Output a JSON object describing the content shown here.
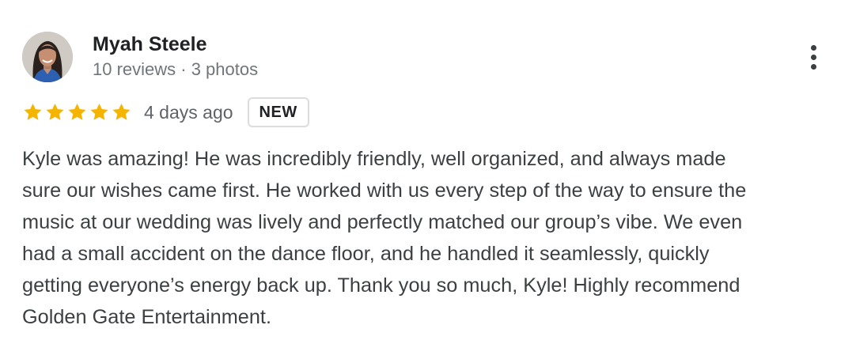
{
  "reviewer": {
    "name": "Myah Steele",
    "meta": "10 reviews · 3 photos",
    "avatar_icon": "profile-photo"
  },
  "review": {
    "rating": 5,
    "rating_max": 5,
    "star_color": "#f4b400",
    "date": "4 days ago",
    "badge": "NEW",
    "text": "Kyle was amazing! He was incredibly friendly, well organized, and always made\nsure our wishes came first. He worked with us every step of the way to ensure the\nmusic at our wedding was lively and perfectly matched our group’s vibe. We even\nhad a small accident on the dance floor, and he handled it seamlessly, quickly\ngetting everyone’s energy back up. Thank you so much, Kyle! Highly recommend\nGolden Gate Entertainment."
  },
  "actions": {
    "more_icon": "more-vert-icon"
  }
}
